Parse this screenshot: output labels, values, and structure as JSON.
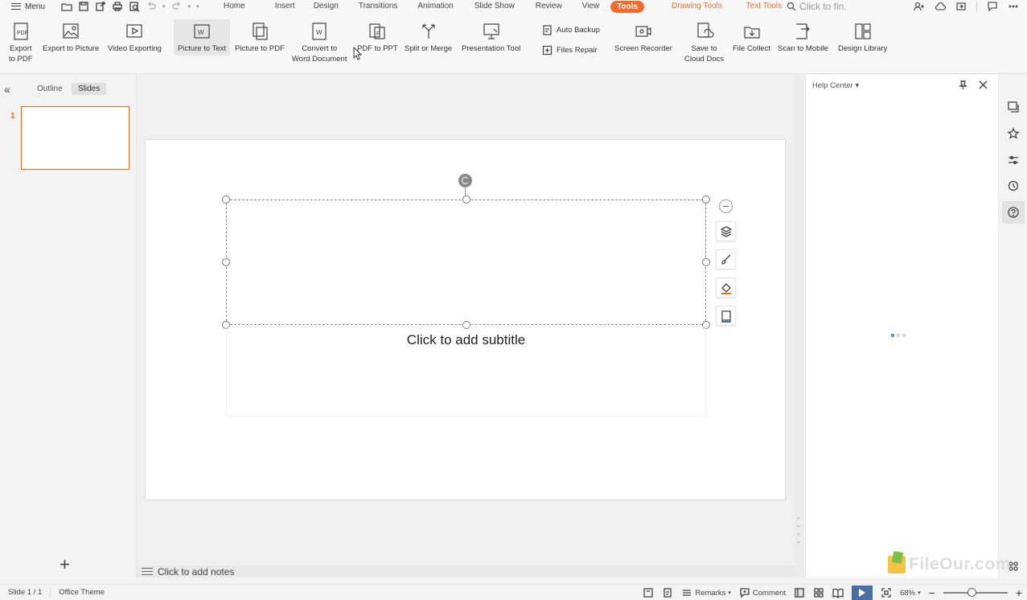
{
  "menubar": {
    "menu_label": "Menu",
    "tabs": [
      {
        "label": "Home"
      },
      {
        "label": "Insert"
      },
      {
        "label": "Design"
      },
      {
        "label": "Transitions"
      },
      {
        "label": "Animation"
      },
      {
        "label": "Slide Show"
      },
      {
        "label": "Review"
      },
      {
        "label": "View"
      },
      {
        "label": "Tools"
      },
      {
        "label": "Drawing Tools"
      },
      {
        "label": "Text Tools"
      }
    ],
    "active_tab": "Tools",
    "search_placeholder": "Click to fin."
  },
  "ribbon": {
    "buttons": [
      {
        "label1": "Export",
        "label2": "to PDF",
        "icon": "export-pdf-icon"
      },
      {
        "label1": "Export to Picture",
        "label2": "",
        "icon": "export-picture-icon"
      },
      {
        "label1": "Video Exporting",
        "label2": "",
        "icon": "video-export-icon"
      },
      {
        "label1": "Picture to Text",
        "label2": "",
        "icon": "picture-to-text-icon"
      },
      {
        "label1": "Picture to PDF",
        "label2": "",
        "icon": "picture-to-pdf-icon"
      },
      {
        "label1": "Convert to",
        "label2": "Word Document",
        "icon": "convert-word-icon"
      },
      {
        "label1": "PDF to PPT",
        "label2": "",
        "icon": "pdf-to-ppt-icon"
      },
      {
        "label1": "Split or Merge",
        "label2": "",
        "icon": "split-merge-icon"
      },
      {
        "label1": "Presentation Tool",
        "label2": "",
        "icon": "presentation-tool-icon"
      },
      {
        "label1": "Screen Recorder",
        "label2": "",
        "icon": "screen-recorder-icon"
      },
      {
        "label1": "Save to",
        "label2": "Cloud Docs",
        "icon": "cloud-save-icon"
      },
      {
        "label1": "File Collect",
        "label2": "",
        "icon": "file-collect-icon"
      },
      {
        "label1": "Scan to Mobile",
        "label2": "",
        "icon": "scan-mobile-icon"
      },
      {
        "label1": "Design Library",
        "label2": "",
        "icon": "design-library-icon"
      }
    ],
    "small": [
      {
        "label": "Auto Backup",
        "icon": "auto-backup-icon"
      },
      {
        "label": "Files Repair",
        "icon": "files-repair-icon"
      }
    ]
  },
  "leftpanel": {
    "tab_outline": "Outline",
    "tab_slides": "Slides",
    "active_tab": "Slides",
    "slide_number": "1"
  },
  "slide": {
    "subtitle_placeholder": "Click to add subtitle"
  },
  "notes": {
    "placeholder": "Click to add notes"
  },
  "helpcenter": {
    "title": "Help Center"
  },
  "statusbar": {
    "slide_indicator": "Slide 1 / 1",
    "theme": "Office Theme",
    "remarks": "Remarks",
    "comment": "Comment",
    "zoom": "68%"
  },
  "watermark": {
    "text": "FileOur.com"
  },
  "colors": {
    "accent": "#f26b2e",
    "selection": "#e06b2b",
    "play": "#4a6fa5"
  }
}
